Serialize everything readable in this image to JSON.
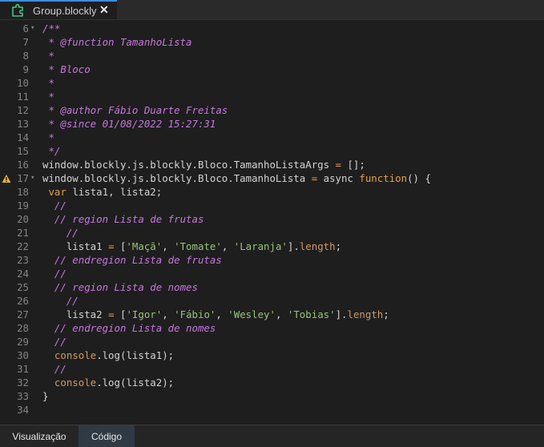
{
  "tab": {
    "title": "Group.blockly",
    "close_label": "✕"
  },
  "bottom_tabs": [
    {
      "label": "Visualização",
      "active": false
    },
    {
      "label": "Código",
      "active": true
    }
  ],
  "lines": [
    {
      "num": "6",
      "fold": true,
      "warn": false,
      "segs": [
        {
          "t": "/**",
          "c": "cm"
        }
      ]
    },
    {
      "num": "7",
      "fold": false,
      "warn": false,
      "segs": [
        {
          "t": " * @function TamanhoLista",
          "c": "cm"
        }
      ]
    },
    {
      "num": "8",
      "fold": false,
      "warn": false,
      "segs": [
        {
          "t": " *",
          "c": "cm"
        }
      ]
    },
    {
      "num": "9",
      "fold": false,
      "warn": false,
      "segs": [
        {
          "t": " * Bloco",
          "c": "cm"
        }
      ]
    },
    {
      "num": "10",
      "fold": false,
      "warn": false,
      "segs": [
        {
          "t": " *",
          "c": "cm"
        }
      ]
    },
    {
      "num": "11",
      "fold": false,
      "warn": false,
      "segs": [
        {
          "t": " *",
          "c": "cm"
        }
      ]
    },
    {
      "num": "12",
      "fold": false,
      "warn": false,
      "segs": [
        {
          "t": " * @author Fábio Duarte Freitas",
          "c": "cm"
        }
      ]
    },
    {
      "num": "13",
      "fold": false,
      "warn": false,
      "segs": [
        {
          "t": " * @since 01/08/2022 15:27:31",
          "c": "cm"
        }
      ]
    },
    {
      "num": "14",
      "fold": false,
      "warn": false,
      "segs": [
        {
          "t": " *",
          "c": "cm"
        }
      ]
    },
    {
      "num": "15",
      "fold": false,
      "warn": false,
      "segs": [
        {
          "t": " */",
          "c": "cm"
        }
      ]
    },
    {
      "num": "16",
      "fold": false,
      "warn": false,
      "segs": [
        {
          "t": "window.blockly.js.blockly.Bloco.TamanhoListaArgs ",
          "c": ""
        },
        {
          "t": "=",
          "c": "op"
        },
        {
          "t": " [];",
          "c": ""
        }
      ]
    },
    {
      "num": "17",
      "fold": true,
      "warn": true,
      "segs": [
        {
          "t": "window.blockly.js.blockly.Bloco.TamanhoLista ",
          "c": ""
        },
        {
          "t": "=",
          "c": "op"
        },
        {
          "t": " async ",
          "c": ""
        },
        {
          "t": "function",
          "c": "kw"
        },
        {
          "t": "() {",
          "c": ""
        }
      ]
    },
    {
      "num": "18",
      "fold": false,
      "warn": false,
      "segs": [
        {
          "t": " ",
          "c": ""
        },
        {
          "t": "var",
          "c": "kw"
        },
        {
          "t": " lista1, lista2;",
          "c": ""
        }
      ]
    },
    {
      "num": "19",
      "fold": false,
      "warn": false,
      "segs": [
        {
          "t": "  //",
          "c": "cm"
        }
      ]
    },
    {
      "num": "20",
      "fold": false,
      "warn": false,
      "segs": [
        {
          "t": "  // region Lista de frutas",
          "c": "cm"
        }
      ]
    },
    {
      "num": "21",
      "fold": false,
      "warn": false,
      "segs": [
        {
          "t": "    //",
          "c": "cm"
        }
      ]
    },
    {
      "num": "22",
      "fold": false,
      "warn": false,
      "segs": [
        {
          "t": "    lista1 ",
          "c": ""
        },
        {
          "t": "=",
          "c": "op"
        },
        {
          "t": " [",
          "c": ""
        },
        {
          "t": "'Maçã'",
          "c": "str"
        },
        {
          "t": ", ",
          "c": ""
        },
        {
          "t": "'Tomate'",
          "c": "str"
        },
        {
          "t": ", ",
          "c": ""
        },
        {
          "t": "'Laranja'",
          "c": "str"
        },
        {
          "t": "].",
          "c": ""
        },
        {
          "t": "length",
          "c": "prop"
        },
        {
          "t": ";",
          "c": ""
        }
      ]
    },
    {
      "num": "23",
      "fold": false,
      "warn": false,
      "segs": [
        {
          "t": "  // endregion Lista de frutas",
          "c": "cm"
        }
      ]
    },
    {
      "num": "24",
      "fold": false,
      "warn": false,
      "segs": [
        {
          "t": "  //",
          "c": "cm"
        }
      ]
    },
    {
      "num": "25",
      "fold": false,
      "warn": false,
      "segs": [
        {
          "t": "  // region Lista de nomes",
          "c": "cm"
        }
      ]
    },
    {
      "num": "26",
      "fold": false,
      "warn": false,
      "segs": [
        {
          "t": "    //",
          "c": "cm"
        }
      ]
    },
    {
      "num": "27",
      "fold": false,
      "warn": false,
      "segs": [
        {
          "t": "    lista2 ",
          "c": ""
        },
        {
          "t": "=",
          "c": "op"
        },
        {
          "t": " [",
          "c": ""
        },
        {
          "t": "'Igor'",
          "c": "str"
        },
        {
          "t": ", ",
          "c": ""
        },
        {
          "t": "'Fábio'",
          "c": "str"
        },
        {
          "t": ", ",
          "c": ""
        },
        {
          "t": "'Wesley'",
          "c": "str"
        },
        {
          "t": ", ",
          "c": ""
        },
        {
          "t": "'Tobias'",
          "c": "str"
        },
        {
          "t": "].",
          "c": ""
        },
        {
          "t": "length",
          "c": "prop"
        },
        {
          "t": ";",
          "c": ""
        }
      ]
    },
    {
      "num": "28",
      "fold": false,
      "warn": false,
      "segs": [
        {
          "t": "  // endregion Lista de nomes",
          "c": "cm"
        }
      ]
    },
    {
      "num": "29",
      "fold": false,
      "warn": false,
      "segs": [
        {
          "t": "  //",
          "c": "cm"
        }
      ]
    },
    {
      "num": "30",
      "fold": false,
      "warn": false,
      "segs": [
        {
          "t": "  ",
          "c": ""
        },
        {
          "t": "console",
          "c": "prop"
        },
        {
          "t": ".log(lista1);",
          "c": ""
        }
      ]
    },
    {
      "num": "31",
      "fold": false,
      "warn": false,
      "segs": [
        {
          "t": "  //",
          "c": "cm"
        }
      ]
    },
    {
      "num": "32",
      "fold": false,
      "warn": false,
      "segs": [
        {
          "t": "  ",
          "c": ""
        },
        {
          "t": "console",
          "c": "prop"
        },
        {
          "t": ".log(lista2);",
          "c": ""
        }
      ]
    },
    {
      "num": "33",
      "fold": false,
      "warn": false,
      "segs": [
        {
          "t": "}",
          "c": ""
        }
      ]
    },
    {
      "num": "34",
      "fold": false,
      "warn": false,
      "segs": []
    }
  ],
  "icons": {
    "tab": "puzzle-piece-icon",
    "warning": "warning-triangle-icon",
    "fold": "chevron-down-icon"
  },
  "colors": {
    "comment": "#c678dd",
    "keyword": "#e4a14a",
    "string": "#98c379",
    "accent": "#3b8de0"
  }
}
